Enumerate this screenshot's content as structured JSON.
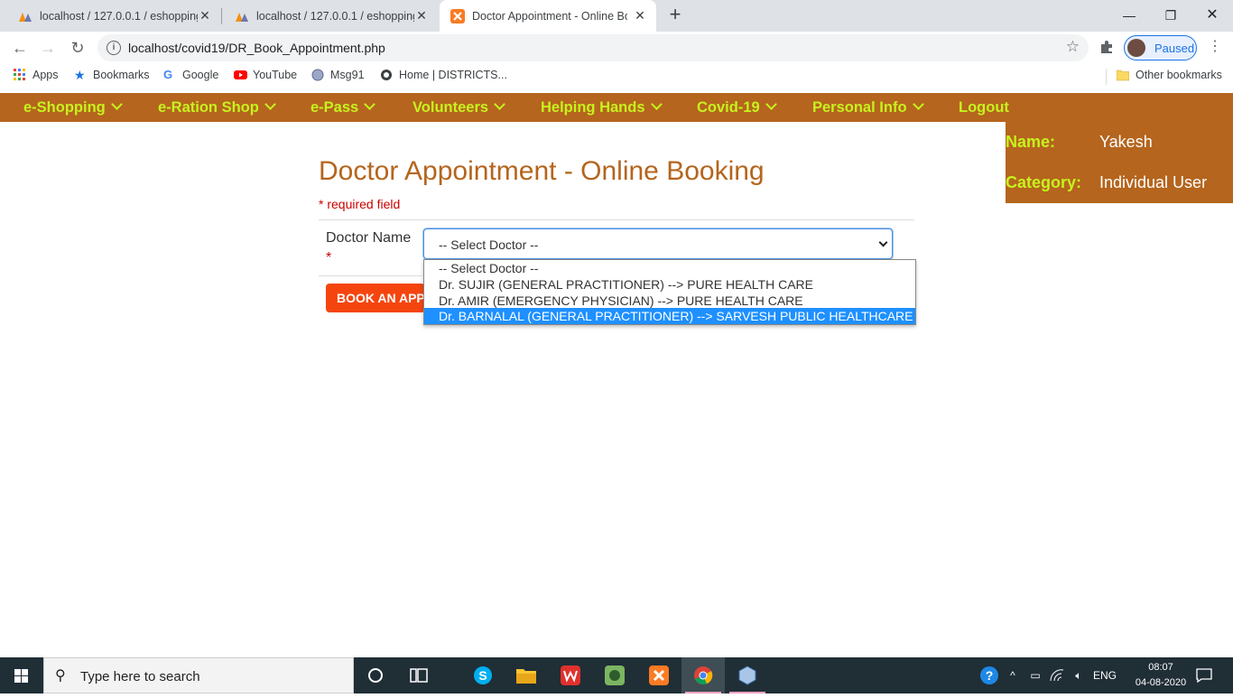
{
  "browser": {
    "tabs": [
      {
        "title": "localhost / 127.0.0.1 / eshopping"
      },
      {
        "title": "localhost / 127.0.0.1 / eshopping"
      },
      {
        "title": "Doctor Appointment - Online Bo"
      }
    ],
    "url": "localhost/covid19/DR_Book_Appointment.php",
    "profile_label": "Paused",
    "bookmarks": [
      "Apps",
      "Bookmarks",
      "Google",
      "YouTube",
      "Msg91",
      "Home | DISTRICTS...",
      "Other bookmarks"
    ]
  },
  "nav": {
    "items": [
      "e-Shopping",
      "e-Ration Shop",
      "e-Pass",
      "Volunteers",
      "Helping Hands",
      "Covid-19",
      "Personal Info",
      "Logout"
    ]
  },
  "user": {
    "name_label": "Name:",
    "name_value": "Yakesh",
    "category_label": "Category:",
    "category_value": "Individual User"
  },
  "form": {
    "heading": "Doctor Appointment - Online Booking",
    "required_note": "* required field",
    "doctor_label": "Doctor Name",
    "required_star": "*",
    "select_value": "-- Select Doctor --",
    "book_button": "BOOK AN APPOINTMENT",
    "options": [
      "-- Select Doctor --",
      "Dr. SUJIR (GENERAL PRACTITIONER) --> PURE HEALTH CARE",
      "Dr. AMIR (EMERGENCY PHYSICIAN) --> PURE HEALTH CARE",
      "Dr. BARNALAL (GENERAL PRACTITIONER) --> SARVESH PUBLIC HEALTHCARE"
    ],
    "highlighted_option_index": 3
  },
  "taskbar": {
    "search_placeholder": "Type here to search",
    "language": "ENG",
    "time": "08:07",
    "date": "04-08-2020"
  },
  "colors": {
    "brand": "#b5651d",
    "nav_text": "#c6f21e",
    "button": "#f5450f",
    "highlight": "#1e90ff"
  }
}
